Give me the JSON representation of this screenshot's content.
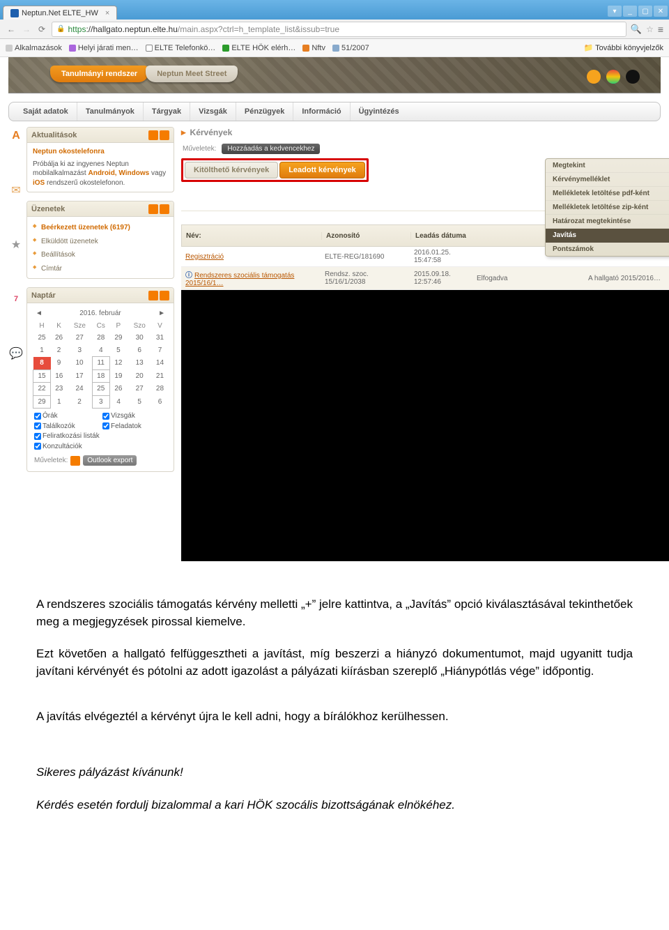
{
  "browser": {
    "tab_title": "Neptun.Net ELTE_HW",
    "win_icons": [
      "▢",
      "_",
      "◻",
      "✕"
    ],
    "url_https": "https",
    "url_domain": "://hallgato.neptun.elte.hu",
    "url_rest": "/main.aspx?ctrl=h_template_list&issub=true",
    "bookmarks": {
      "apps": "Alkalmazások",
      "b1": "Helyi járati men…",
      "b2": "ELTE Telefonkö…",
      "b3": "ELTE HÖK elérh…",
      "b4": "Nftv",
      "b5": "51/2007",
      "more": "További könyvjelzők"
    }
  },
  "header": {
    "tab1": "Tanulmányi rendszer",
    "tab2": "Neptun Meet Street"
  },
  "menu": [
    "Saját adatok",
    "Tanulmányok",
    "Tárgyak",
    "Vizsgák",
    "Pénzügyek",
    "Információ",
    "Ügyintézés"
  ],
  "panels": {
    "aktual": {
      "title": "Aktualitások",
      "h": "Neptun okostelefonra",
      "body1": "Próbálja ki az ingyenes Neptun mobilalkalmazást ",
      "bold": "Android, Windows",
      "body2": " vagy ",
      "bold2": "iOS",
      "body3": " rendszerű okostelefonon."
    },
    "uzen": {
      "title": "Üzenetek",
      "items": [
        "Beérkezett üzenetek (6197)",
        "Elküldött üzenetek",
        "Beállítások",
        "Címtár"
      ]
    },
    "naptar": {
      "title": "Naptár",
      "month": "2016. február",
      "days": [
        "H",
        "K",
        "Sze",
        "Cs",
        "P",
        "Szo",
        "V"
      ],
      "rows": [
        [
          "25",
          "26",
          "27",
          "28",
          "29",
          "30",
          "31"
        ],
        [
          "1",
          "2",
          "3",
          "4",
          "5",
          "6",
          "7"
        ],
        [
          "8",
          "9",
          "10",
          "11",
          "12",
          "13",
          "14"
        ],
        [
          "15",
          "16",
          "17",
          "18",
          "19",
          "20",
          "21"
        ],
        [
          "22",
          "23",
          "24",
          "25",
          "26",
          "27",
          "28"
        ],
        [
          "29",
          "1",
          "2",
          "3",
          "4",
          "5",
          "6"
        ]
      ],
      "checks": [
        "Órák",
        "Vizsgák",
        "Találkozók",
        "Feladatok",
        "Feliratkozási listák",
        "Konzultációk"
      ],
      "muv": "Műveletek:",
      "export": "Outlook export"
    }
  },
  "main": {
    "title": "Kérvények",
    "muv": "Műveletek:",
    "fav": "Hozzáadás a kedvencekhez",
    "tab_inactive": "Kitölthető kérvények",
    "tab_active": "Leadott kérvények",
    "cols": [
      "Név:",
      "Azonosító",
      "Leadás dátuma",
      "",
      "",
      ""
    ],
    "col3": "Leadás dátuma",
    "rows": [
      {
        "name": "Regisztráció",
        "id": "ELTE-REG/181690",
        "date": "2016.01.25. 15:47:58",
        "status": "",
        "info": ""
      },
      {
        "name": "Rendszeres szociális támogatás 2015/16/1…",
        "id": "Rendsz. szoc. 15/16/1/2038",
        "date": "2015.09.18. 12:57:46",
        "status": "Elfogadva",
        "info": "A hallgató 2015/2016…"
      }
    ],
    "ctx": [
      "Megtekint",
      "Kérvénymelléklet",
      "Mellékletek letöltése pdf-ként",
      "Mellékletek letöltése zip-ként",
      "Határozat megtekintése",
      "Javítás",
      "Pontszámok"
    ]
  },
  "doc": {
    "p1": "A rendszeres szociális támogatás kérvény melletti „+” jelre kattintva, a „Javítás” opció kiválasztásával tekinthetőek meg a megjegyzések pirossal kiemelve.",
    "p2": "Ezt követően a hallgató felfüggesztheti a javítást, míg beszerzi a hiányzó dokumentumot, majd ugyanitt tudja javítani kérvényét és pótolni az adott igazolást a pályázati kiírásban szereplő „Hiánypótlás vége” időpontig.",
    "p3": "A javítás elvégeztél a kérvényt újra le kell adni, hogy a bírálókhoz kerülhessen.",
    "p4": "Sikeres pályázást kívánunk!",
    "p5": "Kérdés esetén fordulj bizalommal a kari HÖK szocális bizottságának elnökéhez."
  }
}
